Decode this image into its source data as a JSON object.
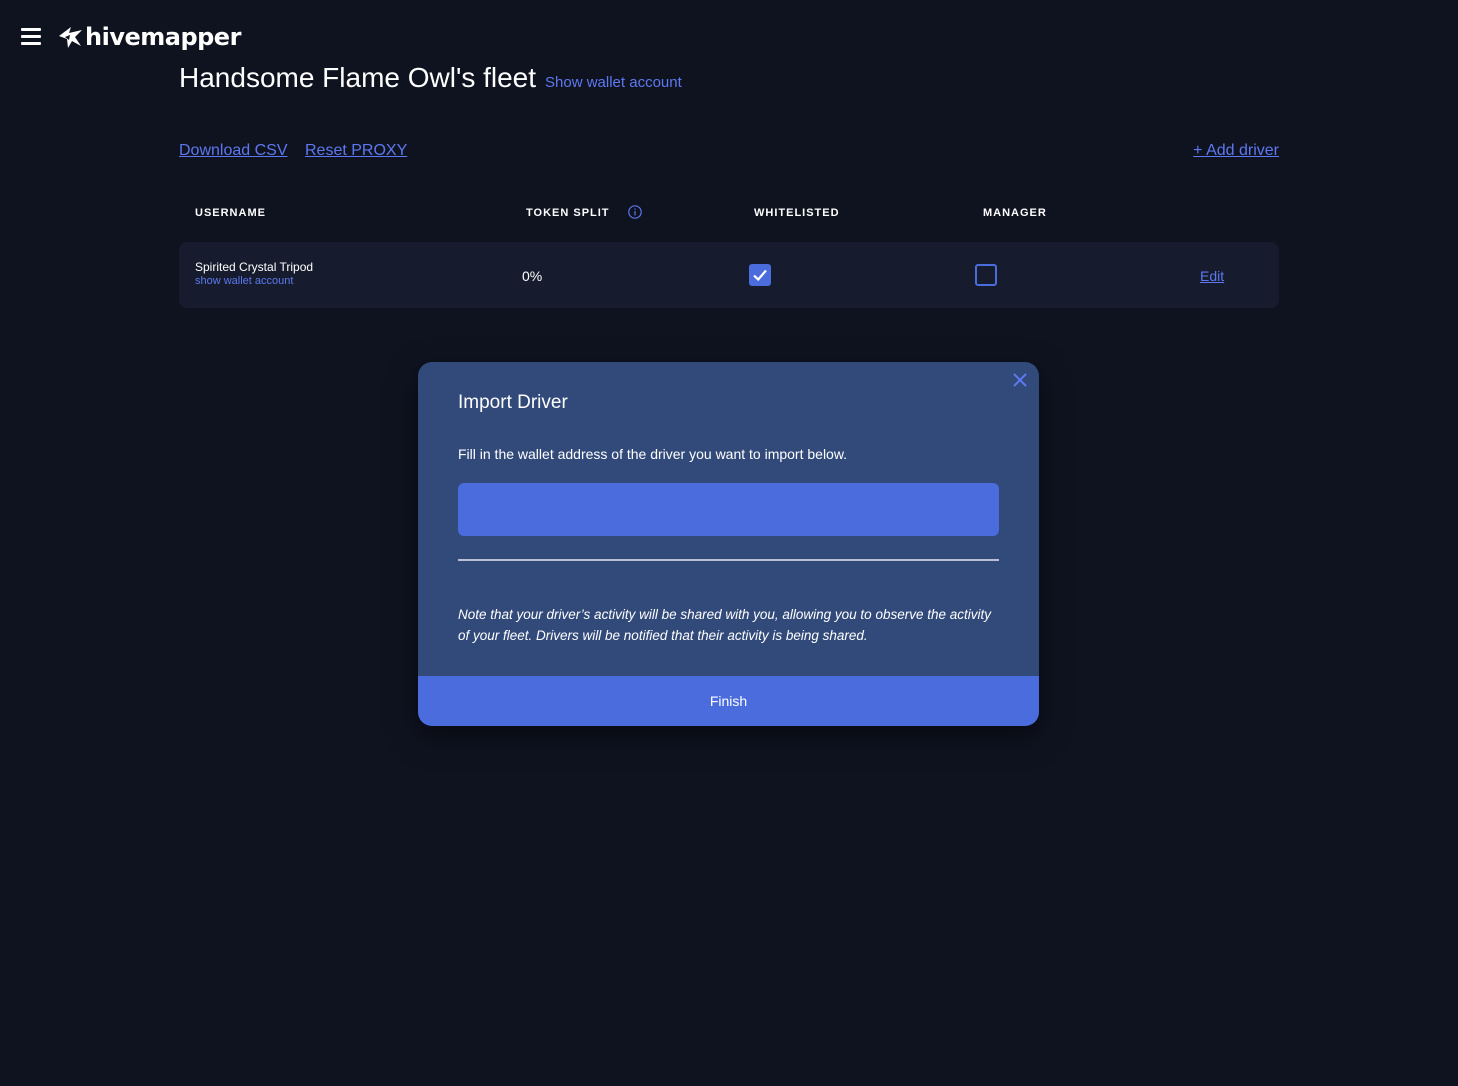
{
  "header": {
    "brand": "hivemapper"
  },
  "fleet": {
    "title": "Handsome Flame Owl's fleet",
    "show_wallet_label": "Show wallet account"
  },
  "actions": {
    "download_csv": "Download CSV",
    "reset_proxy": "Reset PROXY",
    "add_driver": "+ Add driver"
  },
  "table": {
    "columns": [
      "USERNAME",
      "TOKEN SPLIT",
      "WHITELISTED",
      "MANAGER"
    ],
    "rows": [
      {
        "username": "Spirited Crystal Tripod",
        "wallet_link": "show wallet account",
        "token_split": "0%",
        "whitelisted": true,
        "manager": false,
        "edit_label": "Edit"
      }
    ]
  },
  "modal": {
    "title": "Import Driver",
    "description": "Fill in the wallet address of the driver you want to import below.",
    "input_value": "",
    "note": "Note that your driver’s activity will be shared with you, allowing you to observe the activity of your fleet. Drivers will be notified that their activity is being shared.",
    "finish_label": "Finish"
  },
  "colors": {
    "background": "#0f1320",
    "accent": "#4a6cdd",
    "link": "#5d78f0",
    "modal_bg": "#324a7a",
    "row_bg": "#161c2d"
  },
  "icons": {
    "menu": "hamburger-menu-icon",
    "logo": "hivemapper-logo-icon",
    "info": "info-icon",
    "close": "close-icon",
    "check": "checkmark-icon"
  }
}
